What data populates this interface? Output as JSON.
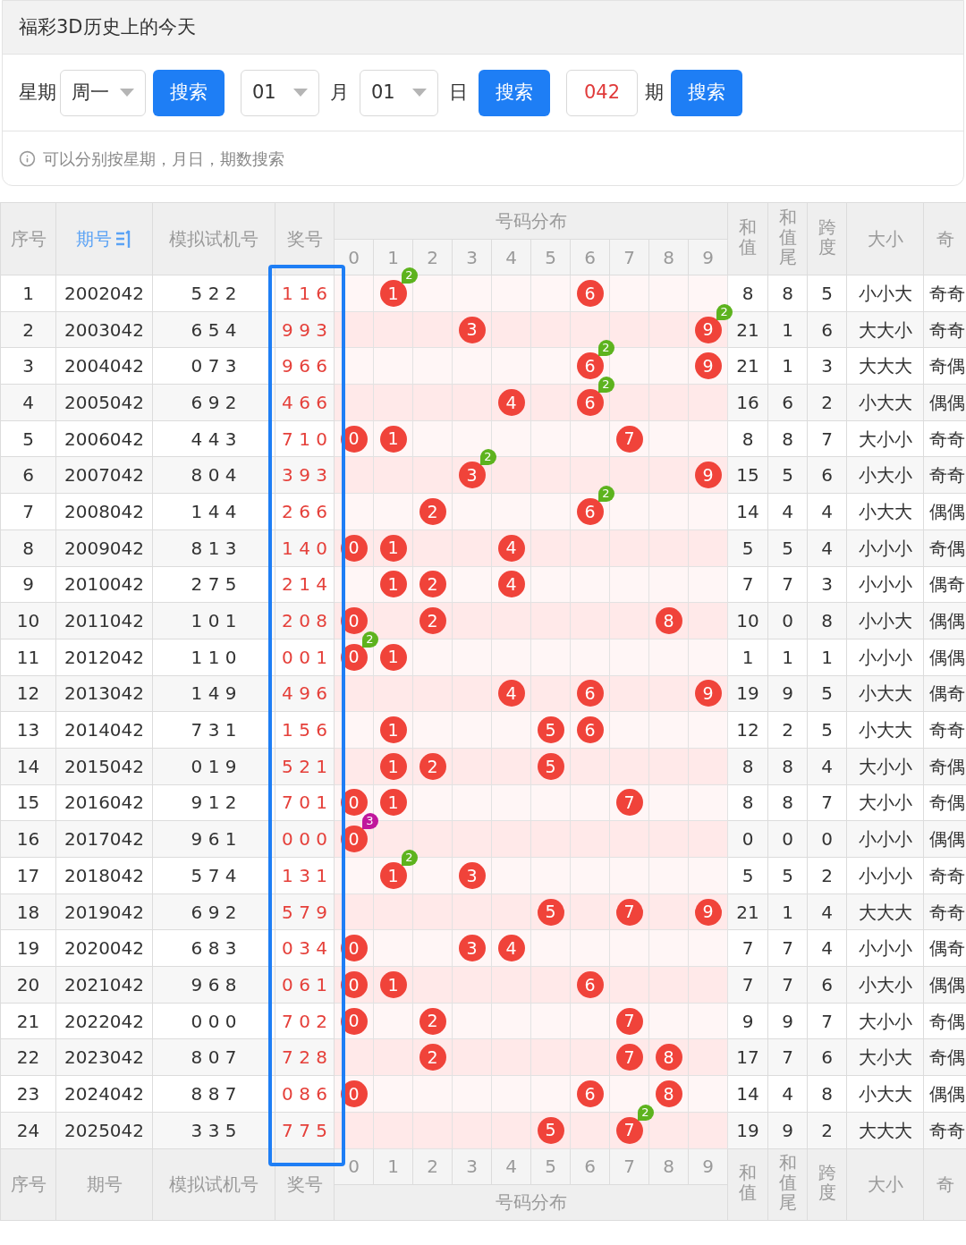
{
  "title": "福彩3D历史上的今天",
  "search": {
    "weekday_label": "星期",
    "weekday": "周一",
    "weekday_button": "搜索",
    "month": "01",
    "month_label": "月",
    "day": "01",
    "day_label": "日",
    "date_button": "搜索",
    "issue": "042",
    "issue_label": "期",
    "issue_button": "搜索"
  },
  "hint": "可以分别按星期，月日，期数搜索",
  "table": {
    "header": {
      "columns": [
        {
          "label": "序号",
          "sorted": false
        },
        {
          "label": "期号",
          "sorted": true
        },
        {
          "label": "模拟试机号",
          "sorted": false
        },
        {
          "label": "奖号",
          "sorted": false
        }
      ],
      "group": "号码分布",
      "digits": [
        "0",
        "1",
        "2",
        "3",
        "4",
        "5",
        "6",
        "7",
        "8",
        "9"
      ],
      "stats": [
        "和值",
        "和值尾",
        "跨度",
        "大小",
        "奇"
      ]
    },
    "rows": [
      {
        "no": "1",
        "issue": "2002042",
        "sim": "5 2 2",
        "prize": "1 1 6",
        "cells": [
          null,
          {
            "ball": "1",
            "badge": {
              "text": "2",
              "color": "#5db31e"
            }
          },
          null,
          null,
          null,
          null,
          {
            "ball": "6"
          },
          null,
          null,
          null
        ],
        "sum": "8",
        "sum_tail": "8",
        "span": "5",
        "size": "小小大",
        "parity": "奇奇"
      },
      {
        "no": "2",
        "issue": "2003042",
        "sim": "6 5 4",
        "prize": "9 9 3",
        "cells": [
          null,
          null,
          null,
          {
            "ball": "3"
          },
          null,
          null,
          null,
          null,
          null,
          {
            "ball": "9",
            "badge": {
              "text": "2",
              "color": "#5db31e"
            }
          }
        ],
        "sum": "21",
        "sum_tail": "1",
        "span": "6",
        "size": "大大小",
        "parity": "奇奇"
      },
      {
        "no": "3",
        "issue": "2004042",
        "sim": "0 7 3",
        "prize": "9 6 6",
        "cells": [
          null,
          null,
          null,
          null,
          null,
          null,
          {
            "ball": "6",
            "badge": {
              "text": "2",
              "color": "#5db31e"
            }
          },
          null,
          null,
          {
            "ball": "9"
          }
        ],
        "sum": "21",
        "sum_tail": "1",
        "span": "3",
        "size": "大大大",
        "parity": "奇偶"
      },
      {
        "no": "4",
        "issue": "2005042",
        "sim": "6 9 2",
        "prize": "4 6 6",
        "cells": [
          null,
          null,
          null,
          null,
          {
            "ball": "4"
          },
          null,
          {
            "ball": "6",
            "badge": {
              "text": "2",
              "color": "#5db31e"
            }
          },
          null,
          null,
          null
        ],
        "sum": "16",
        "sum_tail": "6",
        "span": "2",
        "size": "小大大",
        "parity": "偶偶"
      },
      {
        "no": "5",
        "issue": "2006042",
        "sim": "4 4 3",
        "prize": "7 1 0",
        "cells": [
          {
            "ball": "0"
          },
          {
            "ball": "1"
          },
          null,
          null,
          null,
          null,
          null,
          {
            "ball": "7"
          },
          null,
          null
        ],
        "sum": "8",
        "sum_tail": "8",
        "span": "7",
        "size": "大小小",
        "parity": "奇奇"
      },
      {
        "no": "6",
        "issue": "2007042",
        "sim": "8 0 4",
        "prize": "3 9 3",
        "cells": [
          null,
          null,
          null,
          {
            "ball": "3",
            "badge": {
              "text": "2",
              "color": "#5db31e"
            }
          },
          null,
          null,
          null,
          null,
          null,
          {
            "ball": "9"
          }
        ],
        "sum": "15",
        "sum_tail": "5",
        "span": "6",
        "size": "小大小",
        "parity": "奇奇"
      },
      {
        "no": "7",
        "issue": "2008042",
        "sim": "1 4 4",
        "prize": "2 6 6",
        "cells": [
          null,
          null,
          {
            "ball": "2"
          },
          null,
          null,
          null,
          {
            "ball": "6",
            "badge": {
              "text": "2",
              "color": "#5db31e"
            }
          },
          null,
          null,
          null
        ],
        "sum": "14",
        "sum_tail": "4",
        "span": "4",
        "size": "小大大",
        "parity": "偶偶"
      },
      {
        "no": "8",
        "issue": "2009042",
        "sim": "8 1 3",
        "prize": "1 4 0",
        "cells": [
          {
            "ball": "0"
          },
          {
            "ball": "1"
          },
          null,
          null,
          {
            "ball": "4"
          },
          null,
          null,
          null,
          null,
          null
        ],
        "sum": "5",
        "sum_tail": "5",
        "span": "4",
        "size": "小小小",
        "parity": "奇偶"
      },
      {
        "no": "9",
        "issue": "2010042",
        "sim": "2 7 5",
        "prize": "2 1 4",
        "cells": [
          null,
          {
            "ball": "1"
          },
          {
            "ball": "2"
          },
          null,
          {
            "ball": "4"
          },
          null,
          null,
          null,
          null,
          null
        ],
        "sum": "7",
        "sum_tail": "7",
        "span": "3",
        "size": "小小小",
        "parity": "偶奇"
      },
      {
        "no": "10",
        "issue": "2011042",
        "sim": "1 0 1",
        "prize": "2 0 8",
        "cells": [
          {
            "ball": "0"
          },
          null,
          {
            "ball": "2"
          },
          null,
          null,
          null,
          null,
          null,
          {
            "ball": "8"
          },
          null
        ],
        "sum": "10",
        "sum_tail": "0",
        "span": "8",
        "size": "小小大",
        "parity": "偶偶"
      },
      {
        "no": "11",
        "issue": "2012042",
        "sim": "1 1 0",
        "prize": "0 0 1",
        "cells": [
          {
            "ball": "0",
            "badge": {
              "text": "2",
              "color": "#5db31e"
            }
          },
          {
            "ball": "1"
          },
          null,
          null,
          null,
          null,
          null,
          null,
          null,
          null
        ],
        "sum": "1",
        "sum_tail": "1",
        "span": "1",
        "size": "小小小",
        "parity": "偶偶"
      },
      {
        "no": "12",
        "issue": "2013042",
        "sim": "1 4 9",
        "prize": "4 9 6",
        "cells": [
          null,
          null,
          null,
          null,
          {
            "ball": "4"
          },
          null,
          {
            "ball": "6"
          },
          null,
          null,
          {
            "ball": "9"
          }
        ],
        "sum": "19",
        "sum_tail": "9",
        "span": "5",
        "size": "小大大",
        "parity": "偶奇"
      },
      {
        "no": "13",
        "issue": "2014042",
        "sim": "7 3 1",
        "prize": "1 5 6",
        "cells": [
          null,
          {
            "ball": "1"
          },
          null,
          null,
          null,
          {
            "ball": "5"
          },
          {
            "ball": "6"
          },
          null,
          null,
          null
        ],
        "sum": "12",
        "sum_tail": "2",
        "span": "5",
        "size": "小大大",
        "parity": "奇奇"
      },
      {
        "no": "14",
        "issue": "2015042",
        "sim": "0 1 9",
        "prize": "5 2 1",
        "cells": [
          null,
          {
            "ball": "1"
          },
          {
            "ball": "2"
          },
          null,
          null,
          {
            "ball": "5"
          },
          null,
          null,
          null,
          null
        ],
        "sum": "8",
        "sum_tail": "8",
        "span": "4",
        "size": "大小小",
        "parity": "奇偶"
      },
      {
        "no": "15",
        "issue": "2016042",
        "sim": "9 1 2",
        "prize": "7 0 1",
        "cells": [
          {
            "ball": "0"
          },
          {
            "ball": "1"
          },
          null,
          null,
          null,
          null,
          null,
          {
            "ball": "7"
          },
          null,
          null
        ],
        "sum": "8",
        "sum_tail": "8",
        "span": "7",
        "size": "大小小",
        "parity": "奇偶"
      },
      {
        "no": "16",
        "issue": "2017042",
        "sim": "9 6 1",
        "prize": "0 0 0",
        "cells": [
          {
            "ball": "0",
            "badge": {
              "text": "3",
              "color": "#c0169c"
            }
          },
          null,
          null,
          null,
          null,
          null,
          null,
          null,
          null,
          null
        ],
        "sum": "0",
        "sum_tail": "0",
        "span": "0",
        "size": "小小小",
        "parity": "偶偶"
      },
      {
        "no": "17",
        "issue": "2018042",
        "sim": "5 7 4",
        "prize": "1 3 1",
        "cells": [
          null,
          {
            "ball": "1",
            "badge": {
              "text": "2",
              "color": "#5db31e"
            }
          },
          null,
          {
            "ball": "3"
          },
          null,
          null,
          null,
          null,
          null,
          null
        ],
        "sum": "5",
        "sum_tail": "5",
        "span": "2",
        "size": "小小小",
        "parity": "奇奇"
      },
      {
        "no": "18",
        "issue": "2019042",
        "sim": "6 9 2",
        "prize": "5 7 9",
        "cells": [
          null,
          null,
          null,
          null,
          null,
          {
            "ball": "5"
          },
          null,
          {
            "ball": "7"
          },
          null,
          {
            "ball": "9"
          }
        ],
        "sum": "21",
        "sum_tail": "1",
        "span": "4",
        "size": "大大大",
        "parity": "奇奇"
      },
      {
        "no": "19",
        "issue": "2020042",
        "sim": "6 8 3",
        "prize": "0 3 4",
        "cells": [
          {
            "ball": "0"
          },
          null,
          null,
          {
            "ball": "3"
          },
          {
            "ball": "4"
          },
          null,
          null,
          null,
          null,
          null
        ],
        "sum": "7",
        "sum_tail": "7",
        "span": "4",
        "size": "小小小",
        "parity": "偶奇"
      },
      {
        "no": "20",
        "issue": "2021042",
        "sim": "9 6 8",
        "prize": "0 6 1",
        "cells": [
          {
            "ball": "0"
          },
          {
            "ball": "1"
          },
          null,
          null,
          null,
          null,
          {
            "ball": "6"
          },
          null,
          null,
          null
        ],
        "sum": "7",
        "sum_tail": "7",
        "span": "6",
        "size": "小大小",
        "parity": "偶偶"
      },
      {
        "no": "21",
        "issue": "2022042",
        "sim": "0 0 0",
        "prize": "7 0 2",
        "cells": [
          {
            "ball": "0"
          },
          null,
          {
            "ball": "2"
          },
          null,
          null,
          null,
          null,
          {
            "ball": "7"
          },
          null,
          null
        ],
        "sum": "9",
        "sum_tail": "9",
        "span": "7",
        "size": "大小小",
        "parity": "奇偶"
      },
      {
        "no": "22",
        "issue": "2023042",
        "sim": "8 0 7",
        "prize": "7 2 8",
        "cells": [
          null,
          null,
          {
            "ball": "2"
          },
          null,
          null,
          null,
          null,
          {
            "ball": "7"
          },
          {
            "ball": "8"
          },
          null
        ],
        "sum": "17",
        "sum_tail": "7",
        "span": "6",
        "size": "大小大",
        "parity": "奇偶"
      },
      {
        "no": "23",
        "issue": "2024042",
        "sim": "8 8 7",
        "prize": "0 8 6",
        "cells": [
          {
            "ball": "0"
          },
          null,
          null,
          null,
          null,
          null,
          {
            "ball": "6"
          },
          null,
          {
            "ball": "8"
          },
          null
        ],
        "sum": "14",
        "sum_tail": "4",
        "span": "8",
        "size": "小大大",
        "parity": "偶偶"
      },
      {
        "no": "24",
        "issue": "2025042",
        "sim": "3 3 5",
        "prize": "7 7 5",
        "cells": [
          null,
          null,
          null,
          null,
          null,
          {
            "ball": "5"
          },
          null,
          {
            "ball": "7",
            "badge": {
              "text": "2",
              "color": "#5db31e"
            }
          },
          null,
          null
        ],
        "sum": "19",
        "sum_tail": "9",
        "span": "2",
        "size": "大大大",
        "parity": "奇奇"
      }
    ],
    "footer": {
      "columns": [
        "序号",
        "期号",
        "模拟试机号",
        "奖号"
      ],
      "digits": [
        "0",
        "1",
        "2",
        "3",
        "4",
        "5",
        "6",
        "7",
        "8",
        "9"
      ],
      "group": "号码分布",
      "stats": [
        "和值",
        "和值尾",
        "跨度",
        "大小",
        "奇"
      ]
    }
  }
}
